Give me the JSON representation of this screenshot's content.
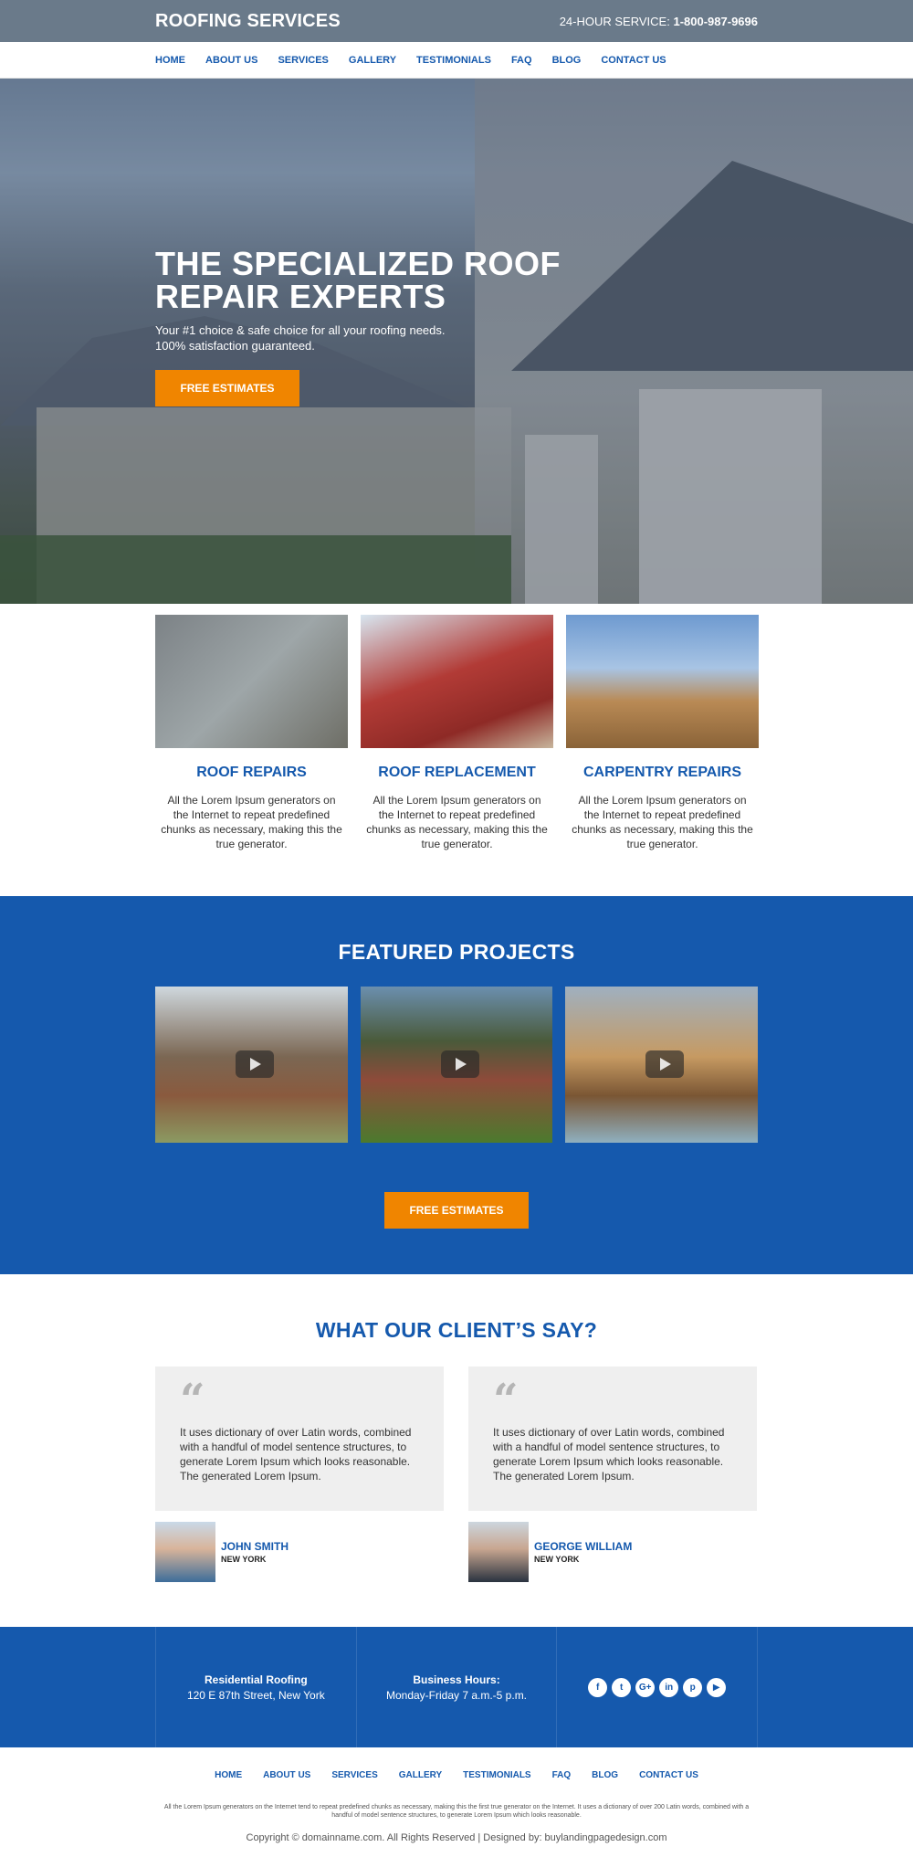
{
  "header": {
    "brand": "ROOFING SERVICES",
    "hotline_label": "24-HOUR SERVICE:",
    "hotline_number": "1-800-987-9696"
  },
  "nav": {
    "items": [
      "HOME",
      "ABOUT US",
      "SERVICES",
      "GALLERY",
      "TESTIMONIALS",
      "FAQ",
      "BLOG",
      "CONTACT US"
    ]
  },
  "hero": {
    "title_line1": "THE SPECIALIZED ROOF",
    "title_line2": "REPAIR EXPERTS",
    "subtitle_line1": "Your #1 choice & safe choice for all your roofing needs.",
    "subtitle_line2": "100% satisfaction guaranteed.",
    "cta": "FREE ESTIMATES"
  },
  "services": [
    {
      "title": "ROOF REPAIRS",
      "text": "All the Lorem Ipsum generators on the Internet to repeat predefined chunks as necessary, making this the true generator."
    },
    {
      "title": "ROOF REPLACEMENT",
      "text": "All the Lorem Ipsum generators on the Internet to repeat predefined chunks as necessary, making this the true generator."
    },
    {
      "title": "CARPENTRY REPAIRS",
      "text": "All the Lorem Ipsum generators on the Internet to repeat predefined chunks as necessary, making this the true generator."
    }
  ],
  "featured": {
    "title": "FEATURED PROJECTS",
    "cta": "FREE ESTIMATES"
  },
  "testimonials": {
    "title": "WHAT OUR CLIENT’S SAY?",
    "items": [
      {
        "quote_mark": "“",
        "text": "It uses dictionary of over Latin words, combined with a handful of model sentence structures, to generate Lorem Ipsum which looks reasonable. The generated Lorem Ipsum.",
        "name": "JOHN SMITH",
        "city": "NEW YORK"
      },
      {
        "quote_mark": "“",
        "text": "It uses dictionary of over Latin words, combined with a handful of model sentence structures, to generate Lorem Ipsum which looks reasonable. The generated Lorem Ipsum.",
        "name": "GEORGE WILLIAM",
        "city": "NEW YORK"
      }
    ]
  },
  "info": {
    "address_title": "Residential Roofing",
    "address": "120 E 87th Street, New York",
    "hours_title": "Business Hours:",
    "hours": "Monday-Friday 7 a.m.-5 p.m.",
    "social": [
      "f",
      "t",
      "G+",
      "in",
      "p",
      "▶"
    ]
  },
  "footer": {
    "nav": [
      "HOME",
      "ABOUT US",
      "SERVICES",
      "GALLERY",
      "TESTIMONIALS",
      "FAQ",
      "BLOG",
      "CONTACT US"
    ],
    "description": "All the Lorem Ipsum generators on the Internet tend to repeat predefined chunks as necessary, making this the first true generator on the Internet. It uses a dictionary of over 200 Latin words, combined with a handful of model sentence structures, to generate Lorem Ipsum which looks reasonable.",
    "copyright": "Copyright © domainname.com. All Rights Reserved  |  Designed by: buylandingpagedesign.com"
  },
  "colors": {
    "primary": "#1559ad",
    "accent": "#f08500"
  }
}
